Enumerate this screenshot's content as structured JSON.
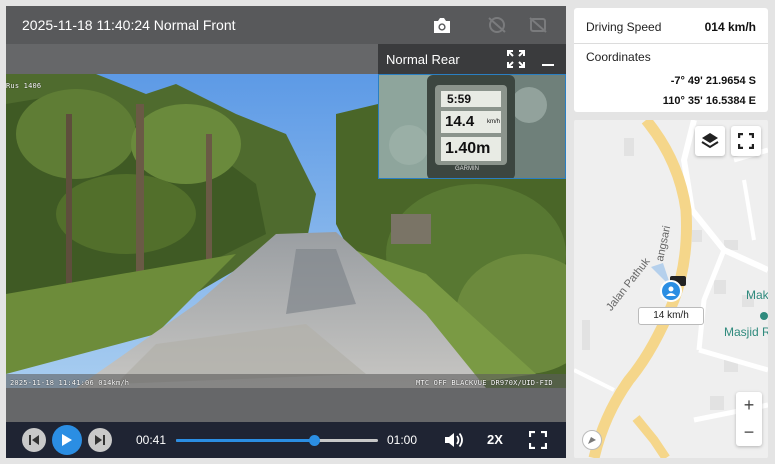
{
  "player": {
    "front_title": "2025-11-18 11:40:24 Normal Front",
    "rear_title": "Normal Rear",
    "osd_top_left": "Rus 1406",
    "osd_bottom_left": "2025-11-18 11:41:06 014km/h",
    "osd_bottom_right": "MTC OFF BLACKVUE DR970X/UID-FID",
    "rear_device": {
      "time": "5:59",
      "speed": "14.4",
      "speed_unit": "km/h",
      "distance": "1.40m",
      "brand": "GARMIN"
    },
    "top_icons": [
      "camera-icon",
      "sync-disabled-icon",
      "share-disabled-icon"
    ],
    "rear_icons": [
      "expand-icon",
      "minimize-icon"
    ]
  },
  "controls": {
    "current_time": "00:41",
    "total_time": "01:00",
    "progress": 0.683,
    "speed": "2X",
    "buttons": [
      "prev-icon",
      "play-icon",
      "next-icon",
      "volume-icon",
      "fullscreen-icon"
    ]
  },
  "info": {
    "driving_speed_label": "Driving Speed",
    "driving_speed_value": "014 km/h",
    "coordinates_label": "Coordinates",
    "lat": "-7° 49' 21.9654 S",
    "lon": "110° 35' 16.5384 E"
  },
  "map": {
    "speed_label": "14 km/h",
    "street_1": "Jalan Pathuk",
    "street_2": "angsari",
    "poi_1": "Mak",
    "poi_2": "Masjid R",
    "zoom_in": "+",
    "zoom_out": "−",
    "colors": {
      "road": "#f5d68a",
      "street": "#ffffff",
      "water": "#b9d7ec",
      "marker": "#2b8ee3"
    }
  }
}
